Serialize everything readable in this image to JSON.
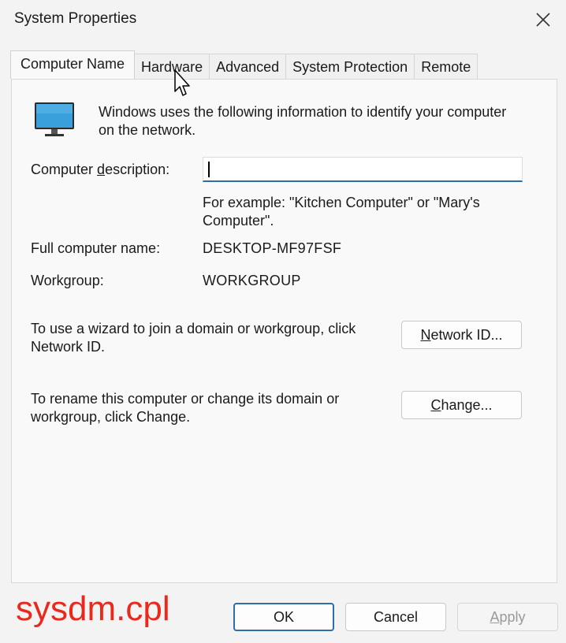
{
  "window": {
    "title": "System Properties"
  },
  "tabs": [
    {
      "label": "Computer Name",
      "active": true
    },
    {
      "label": "Hardware",
      "active": false
    },
    {
      "label": "Advanced",
      "active": false
    },
    {
      "label": "System Protection",
      "active": false
    },
    {
      "label": "Remote",
      "active": false
    }
  ],
  "panel": {
    "intro": "Windows uses the following information to identify your computer on the network.",
    "description": {
      "label_pre": "Computer ",
      "label_accel": "d",
      "label_post": "escription:",
      "value": "",
      "placeholder": ""
    },
    "example": "For example: \"Kitchen Computer\" or \"Mary's Computer\".",
    "full_name": {
      "label": "Full computer name:",
      "value": "DESKTOP-MF97FSF"
    },
    "workgroup": {
      "label": "Workgroup:",
      "value": "WORKGROUP"
    },
    "domain_wizard_text": "To use a wizard to join a domain or workgroup, click Network ID.",
    "network_id_button": {
      "accel": "N",
      "rest": "etwork ID..."
    },
    "rename_text": "To rename this computer or change its domain or workgroup, click Change.",
    "change_button": {
      "accel": "C",
      "rest": "hange..."
    }
  },
  "footer": {
    "ok": "OK",
    "cancel": "Cancel",
    "apply_accel": "A",
    "apply_rest": "pply"
  },
  "overlay_text": "sysdm.cpl",
  "colors": {
    "accent": "#2f6da8",
    "overlay": "#e8291c",
    "monitor_screen": "#3aa0dc"
  },
  "icons": [
    "close-icon",
    "computer-monitor-icon",
    "mouse-pointer-icon"
  ]
}
